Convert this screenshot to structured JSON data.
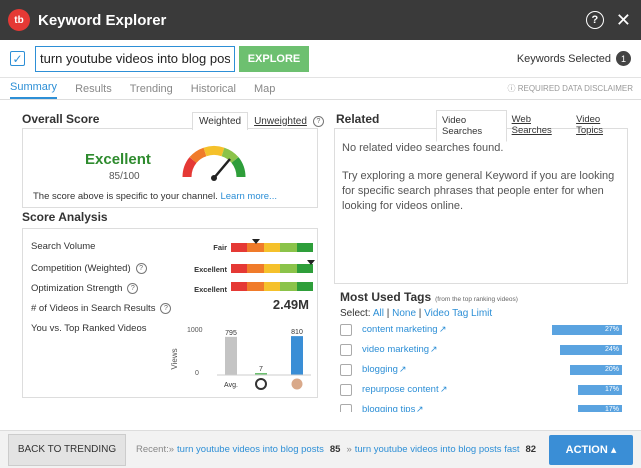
{
  "window": {
    "title": "Keyword Explorer",
    "logo_text": "tb"
  },
  "search": {
    "value": "turn youtube videos into blog posts",
    "explore_label": "EXPLORE",
    "keywords_selected_label": "Keywords Selected",
    "keywords_selected_count": "1"
  },
  "tabs": [
    "Summary",
    "Results",
    "Trending",
    "Historical",
    "Map"
  ],
  "disclaimer": "REQUIRED DATA DISCLAIMER",
  "overall": {
    "title": "Overall Score",
    "tab_weighted": "Weighted",
    "tab_unweighted": "Unweighted",
    "rating": "Excellent",
    "score": "85/100",
    "gauge_value": 85,
    "note": "The score above is specific to your channel.",
    "learn_more": "Learn more..."
  },
  "analysis": {
    "title": "Score Analysis",
    "metrics": [
      {
        "label": "Search Volume",
        "rating": "Fair",
        "pointer_frac": 0.3
      },
      {
        "label": "Competition (Weighted)",
        "rating": "Excellent",
        "pointer_frac": 0.98
      },
      {
        "label": "Optimization Strength",
        "rating": "Excellent",
        "pointer_frac": 0.98
      }
    ],
    "videos_label": "# of Videos in Search Results",
    "videos_value": "2.49M",
    "compare_label": "You vs. Top Ranked Videos",
    "chart_data": {
      "type": "bar",
      "categories": [
        "Avg.",
        "You",
        "Top"
      ],
      "values": [
        795,
        7,
        810
      ],
      "ylabel": "Views",
      "yticks": [
        "1000",
        "0"
      ],
      "ylim": [
        0,
        1000
      ],
      "x_label_avg": "Avg."
    }
  },
  "related": {
    "title": "Related",
    "tabs": [
      "Video Searches",
      "Web Searches",
      "Video Topics"
    ],
    "empty": "No related video searches found.",
    "hint": "Try exploring a more general Keyword if you are looking for specific search phrases that people enter for when looking for videos online."
  },
  "tags": {
    "title": "Most Used Tags",
    "subtitle": "(from the top ranking videos)",
    "select_label": "Select:",
    "all": "All",
    "none": "None",
    "limit": "Video Tag Limit",
    "items": [
      {
        "name": "content marketing",
        "pct": "27%",
        "frac": 0.27
      },
      {
        "name": "video marketing",
        "pct": "24%",
        "frac": 0.24
      },
      {
        "name": "blogging",
        "pct": "20%",
        "frac": 0.2
      },
      {
        "name": "repurpose content",
        "pct": "17%",
        "frac": 0.17
      },
      {
        "name": "blogging tips",
        "pct": "17%",
        "frac": 0.17
      }
    ]
  },
  "footer": {
    "back_label": "BACK TO TRENDING",
    "recent_label": "Recent:»",
    "recent": [
      {
        "text": "turn youtube videos into blog posts",
        "score": "85"
      },
      {
        "text": "turn youtube videos into blog posts fast",
        "score": "82"
      }
    ],
    "action_label": "ACTION"
  },
  "colors": {
    "accent": "#2d8fd6",
    "explore": "#6dc070",
    "titlebar": "#3a3a3a",
    "bar": "#5aa3e0"
  }
}
